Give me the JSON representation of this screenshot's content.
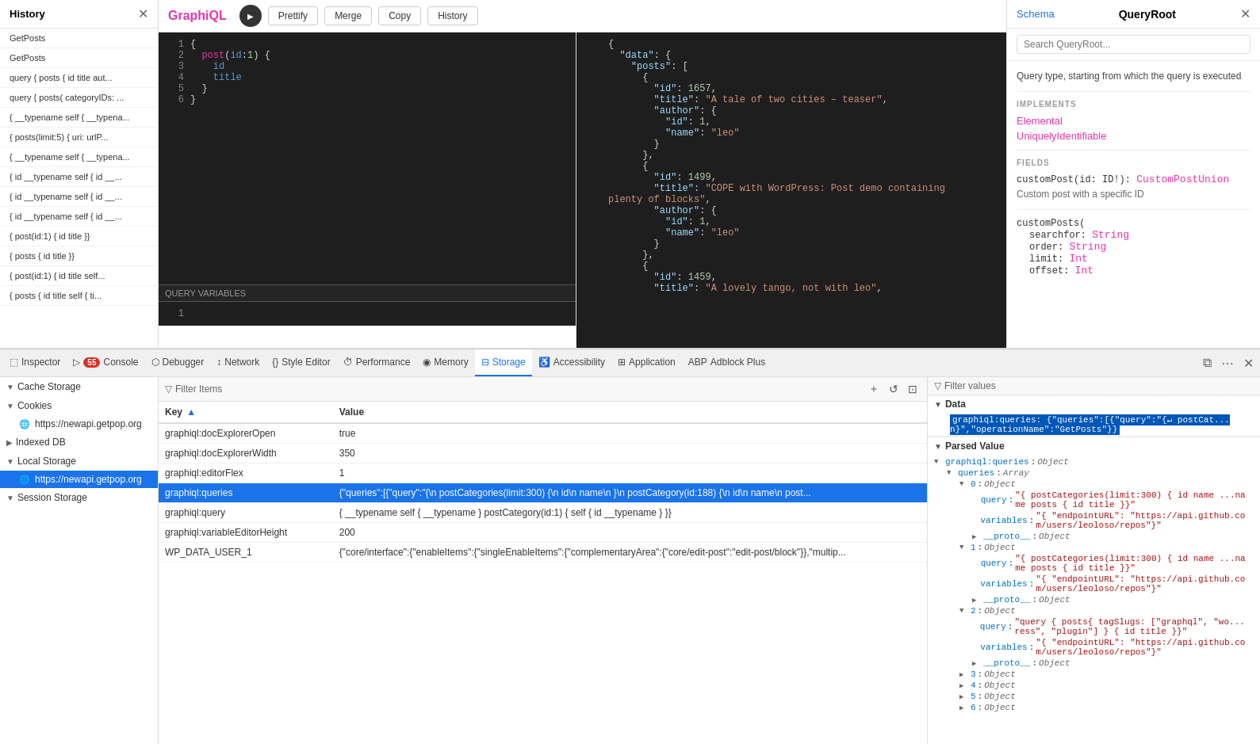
{
  "history": {
    "title": "History",
    "items": [
      "GetPosts",
      "GetPosts",
      "query { posts { id title aut...",
      "query { posts( categoryIDs: ...",
      "{ __typename self { __typena...",
      "{ posts(limit:5) { uri: urlP...",
      "{ __typename self { __typena...",
      "{ id __typename self { id __...",
      "{ id __typename self { id __...",
      "{ id __typename self { id __...",
      "{ post(id:1) { id title }}",
      "{ posts { id title }}",
      "{ post(id:1) { id title self...",
      "{ posts { id title self { ti..."
    ]
  },
  "graphiql": {
    "logo": "GraphiQL",
    "buttons": {
      "prettify": "Prettify",
      "merge": "Merge",
      "copy": "Copy",
      "history": "History"
    },
    "query_variables_label": "QUERY VARIABLES"
  },
  "schema": {
    "back_label": "Schema",
    "title": "QueryRoot",
    "search_placeholder": "Search QueryRoot...",
    "description": "Query type, starting from which the query is executed",
    "implements_label": "IMPLEMENTS",
    "implements": [
      "Elemental",
      "UniquelyIdentifiable"
    ],
    "fields_label": "FIELDS",
    "fields": [
      {
        "sig": "customPost(id: ID!): CustomPostUnion",
        "desc": "Custom post with a specific ID"
      },
      {
        "sig": "customPosts(",
        "params": [
          "searchfor: String",
          "order: String",
          "limit: Int",
          "offset: Int"
        ],
        "type": ""
      }
    ]
  },
  "devtools": {
    "tabs": [
      {
        "label": "Inspector",
        "icon": "⬚",
        "active": false
      },
      {
        "label": "Console",
        "icon": "▷",
        "active": false
      },
      {
        "label": "Debugger",
        "icon": "⬡",
        "active": false
      },
      {
        "label": "Network",
        "icon": "↕",
        "active": false
      },
      {
        "label": "Style Editor",
        "icon": "{}",
        "active": false
      },
      {
        "label": "Performance",
        "icon": "⏱",
        "active": false
      },
      {
        "label": "Memory",
        "icon": "◉",
        "active": false
      },
      {
        "label": "Storage",
        "icon": "☰",
        "active": true
      },
      {
        "label": "Accessibility",
        "icon": "♿",
        "active": false
      },
      {
        "label": "Application",
        "icon": "⊞",
        "active": false
      },
      {
        "label": "Adblock Plus",
        "icon": "ABP",
        "active": false
      }
    ],
    "error_count": "55"
  },
  "storage": {
    "sidebar": {
      "groups": [
        {
          "label": "Cache Storage",
          "expanded": true,
          "items": []
        },
        {
          "label": "Cookies",
          "expanded": true,
          "items": [
            {
              "label": "https://newapi.getpop.org",
              "icon": "🌐"
            }
          ]
        },
        {
          "label": "Indexed DB",
          "expanded": false,
          "items": []
        },
        {
          "label": "Local Storage",
          "expanded": true,
          "items": [
            {
              "label": "https://newapi.getpop.org",
              "icon": "🌐",
              "active": true
            }
          ]
        },
        {
          "label": "Session Storage",
          "expanded": true,
          "items": []
        }
      ]
    },
    "filter_placeholder": "Filter Items",
    "filter_values_placeholder": "Filter values",
    "table": {
      "columns": [
        "Key",
        "Value"
      ],
      "rows": [
        {
          "key": "graphiql:docExplorerOpen",
          "value": "true",
          "selected": false
        },
        {
          "key": "graphiql:docExplorerWidth",
          "value": "350",
          "selected": false
        },
        {
          "key": "graphiql:editorFlex",
          "value": "1",
          "selected": false
        },
        {
          "key": "graphiql:queries",
          "value": "{\"queries\":[{\"query\":\"{\\n postCategories(limit:300) {\\n  id\\n  name\\n }\\n postCategory(id:188) {\\n  id\\n  name\\n  post...",
          "selected": true
        },
        {
          "key": "graphiql:query",
          "value": "{ __typename self { __typename } postCategory(id:1) { self { id  __typename  } }}",
          "selected": false
        },
        {
          "key": "graphiql:variableEditorHeight",
          "value": "200",
          "selected": false
        },
        {
          "key": "WP_DATA_USER_1",
          "value": "{\"core/interface\":{\"enableItems\":{\"singleEnableItems\":{\"complementaryArea\":{\"core/edit-post\":\"edit-post/block\"}},\"multip...",
          "selected": false
        }
      ]
    },
    "right_panel": {
      "data_label": "Data",
      "data_value": "graphiql:queries: {\"queries\":[{\"query\":\"{\\n postCat...n}\",\"operationName\":\"GetPosts\"}}",
      "parsed_label": "Parsed Value",
      "tree": [
        {
          "key": "graphiql:queries",
          "type": "Object",
          "expanded": true,
          "children": [
            {
              "key": "queries",
              "type": "Array",
              "expanded": true,
              "children": [
                {
                  "key": "0",
                  "type": "Object",
                  "expanded": true,
                  "children": [
                    {
                      "key": "query",
                      "value": "\"{ postCategories(limit:300) {  id  name ...name  posts {  id   title  }}\""
                    },
                    {
                      "key": "variables",
                      "value": "\"{ \\\"endpointURL\\\": \\\"https://api.github.com/users/leoloso/repos\\\"}\""
                    },
                    {
                      "key": "__proto__",
                      "type": "Object"
                    }
                  ]
                },
                {
                  "key": "1",
                  "type": "Object",
                  "expanded": true,
                  "children": [
                    {
                      "key": "query",
                      "value": "\"{ postCategories(limit:300) {  id  name ...name  posts {  id   title  }}\""
                    },
                    {
                      "key": "variables",
                      "value": "\"{ \\\"endpointURL\\\": \\\"https://api.github.com/users/leoloso/repos\\\"}\""
                    },
                    {
                      "key": "__proto__",
                      "type": "Object"
                    }
                  ]
                },
                {
                  "key": "2",
                  "type": "Object",
                  "expanded": true,
                  "children": [
                    {
                      "key": "query",
                      "value": "\"query { posts{  tagSlugs: [\\\"graphql\\\", \\\"wo...ress\\\", \\\"plugin\\\"] }  {  id  title  }}\""
                    },
                    {
                      "key": "variables",
                      "value": "\"{ \\\"endpointURL\\\": \\\"https://api.github.com/users/leoloso/repos\\\"}\""
                    },
                    {
                      "key": "__proto__",
                      "type": "Object"
                    }
                  ]
                },
                {
                  "key": "3",
                  "type": "Object",
                  "expanded": false
                },
                {
                  "key": "4",
                  "type": "Object",
                  "expanded": false
                },
                {
                  "key": "5",
                  "type": "Object",
                  "expanded": false
                },
                {
                  "key": "6",
                  "type": "Object",
                  "expanded": false
                }
              ]
            }
          ]
        }
      ]
    }
  }
}
